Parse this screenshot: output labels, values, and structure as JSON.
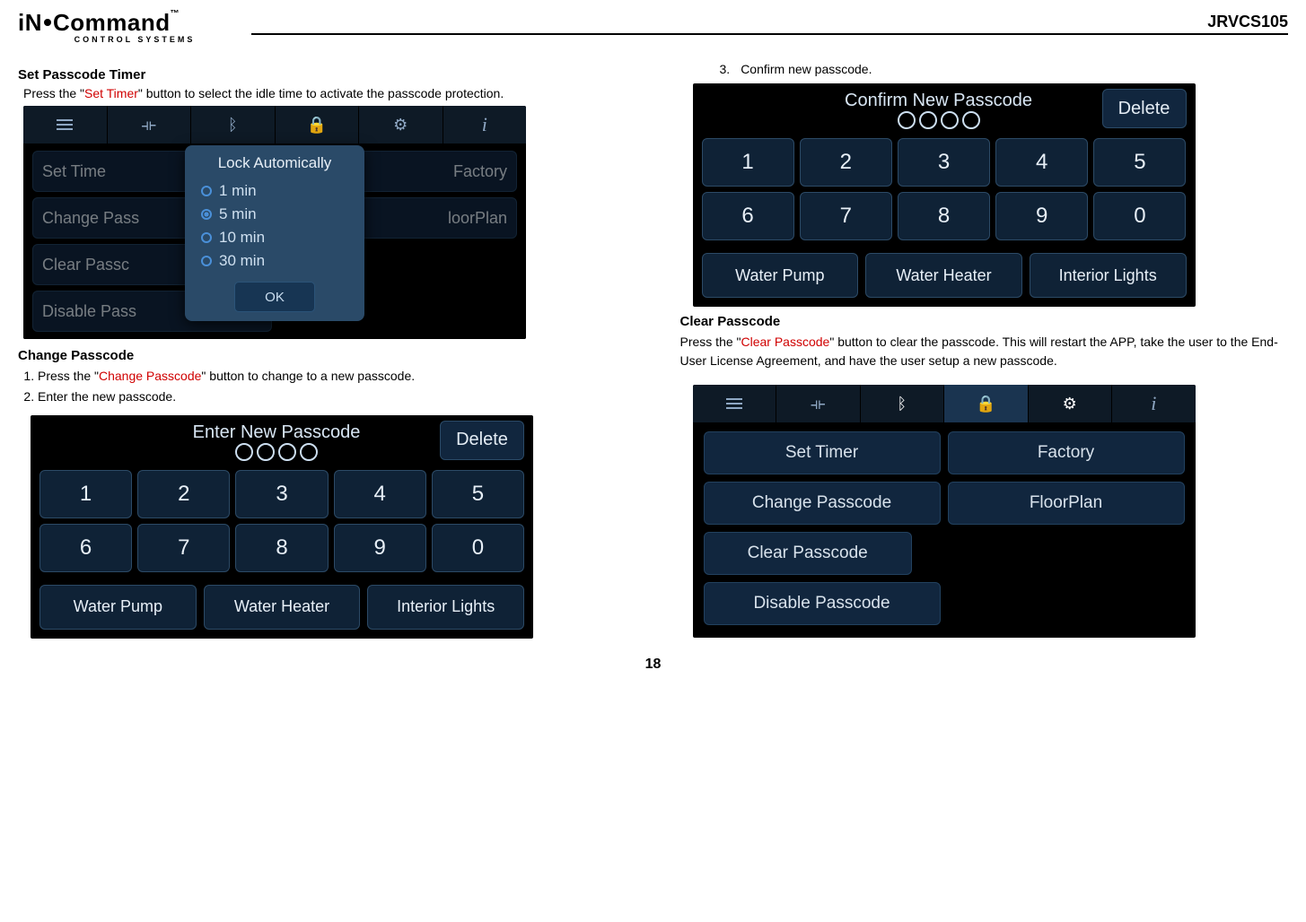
{
  "header": {
    "logo_main": "iN·Command",
    "logo_sub": "CONTROL SYSTEMS",
    "model": "JRVCS105"
  },
  "page_number": "18",
  "left": {
    "set_timer": {
      "title": "Set Passcode Timer",
      "intro_pre": "Press the \"",
      "intro_red": "Set Timer",
      "intro_post": "\" button to select the idle time to activate the passcode protection.",
      "dialog_title": "Lock Automically",
      "options": [
        "1 min",
        "5 min",
        "10 min",
        "30 min"
      ],
      "selected_index": 1,
      "ok": "OK",
      "bg_left": [
        "Set Time",
        "Change Pass",
        "Clear Passc",
        "Disable Pass"
      ],
      "bg_right": [
        "Factory",
        "loorPlan"
      ]
    },
    "change_passcode": {
      "title": "Change Passcode",
      "steps": [
        {
          "pre": "Press the \"",
          "red": "Change Passcode",
          "post": "\" button to change to a new passcode."
        },
        {
          "pre": "Enter the new passcode.",
          "red": "",
          "post": ""
        }
      ],
      "screen_title": "Enter New Passcode",
      "delete": "Delete",
      "keys": [
        "1",
        "2",
        "3",
        "4",
        "5",
        "6",
        "7",
        "8",
        "9",
        "0"
      ],
      "bottom": [
        "Water Pump",
        "Water Heater",
        "Interior Lights"
      ]
    }
  },
  "right": {
    "confirm": {
      "step_num": "3.",
      "step_text": "Confirm new passcode.",
      "screen_title": "Confirm New Passcode",
      "delete": "Delete",
      "keys": [
        "1",
        "2",
        "3",
        "4",
        "5",
        "6",
        "7",
        "8",
        "9",
        "0"
      ],
      "bottom": [
        "Water Pump",
        "Water Heater",
        "Interior Lights"
      ]
    },
    "clear": {
      "title": "Clear Passcode",
      "intro_pre": "Press the \"",
      "intro_red": "Clear Passcode",
      "intro_post": "\" button to clear the passcode. This will restart the APP, take the user to the End-User License Agreement, and have the user setup a new passcode.",
      "left_btns": [
        "Set Timer",
        "Change Passcode",
        "Clear Passcode",
        "Disable Passcode"
      ],
      "right_btns": [
        "Factory",
        "FloorPlan"
      ]
    }
  }
}
